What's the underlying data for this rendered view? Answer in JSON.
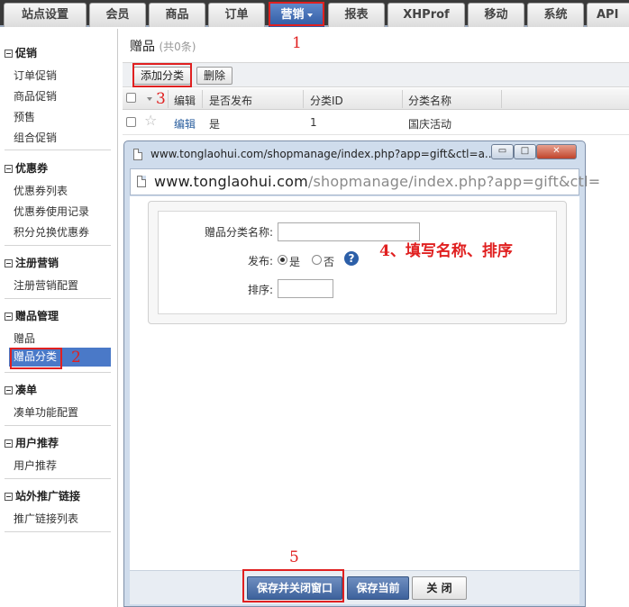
{
  "topnav": {
    "tabs": [
      "站点设置",
      "会员",
      "商品",
      "订单",
      "营销",
      "报表",
      "XHProf",
      "移动",
      "系统",
      "API"
    ],
    "active": "营销"
  },
  "sidebar": {
    "sections": [
      {
        "title": "促销",
        "items": [
          "订单促销",
          "商品促销",
          "预售",
          "组合促销"
        ]
      },
      {
        "title": "优惠券",
        "items": [
          "优惠券列表",
          "优惠券使用记录",
          "积分兑换优惠券"
        ]
      },
      {
        "title": "注册营销",
        "items": [
          "注册营销配置"
        ]
      },
      {
        "title": "赠品管理",
        "items": [
          "赠品",
          "赠品分类"
        ]
      },
      {
        "title": "凑单",
        "items": [
          "凑单功能配置"
        ]
      },
      {
        "title": "用户推荐",
        "items": [
          "用户推荐"
        ]
      },
      {
        "title": "站外推广链接",
        "items": [
          "推广链接列表"
        ]
      }
    ],
    "selected": "赠品分类"
  },
  "main": {
    "title": "赠品",
    "count": "(共0条)",
    "toolbar": {
      "add": "添加分类",
      "delete": "删除"
    },
    "columns": [
      "编辑",
      "是否发布",
      "分类ID",
      "分类名称"
    ],
    "rows": [
      {
        "edit": "编辑",
        "published": "是",
        "id": "1",
        "name": "国庆活动"
      }
    ]
  },
  "popup": {
    "title": "www.tonglaohui.com/shopmanage/index.php?app=gift&ctl=a...",
    "address_domain": "www.tonglaohui.com",
    "address_path": "/shopmanage/index.php?app=gift&ctl=",
    "form": {
      "name_label": "赠品分类名称:",
      "name_value": "",
      "publish_label": "发布:",
      "publish_yes": "是",
      "publish_no": "否",
      "publish_value": "是",
      "order_label": "排序:",
      "order_value": ""
    },
    "buttons": {
      "save_close": "保存并关闭窗口",
      "save": "保存当前",
      "close": "关 闭"
    },
    "window_controls": {
      "minimize": "▭",
      "restore": "□",
      "close": "✕"
    }
  },
  "annotations": {
    "a1": "1",
    "a2": "2",
    "a3": "3",
    "a4": "4、填写名称、排序",
    "a5": "5"
  },
  "colors": {
    "accent": "#3d619c",
    "annotation": "#e02020",
    "selected": "#4a79c8"
  }
}
